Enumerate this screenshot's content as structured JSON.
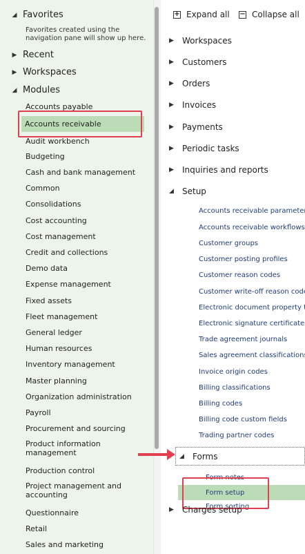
{
  "nav": {
    "favorites_label": "Favorites",
    "favorites_note": "Favorites created using the navigation pane will show up here.",
    "recent_label": "Recent",
    "workspaces_label": "Workspaces",
    "modules_label": "Modules",
    "modules": [
      "Accounts payable",
      "Accounts receivable",
      "Audit workbench",
      "Budgeting",
      "Cash and bank management",
      "Common",
      "Consolidations",
      "Cost accounting",
      "Cost management",
      "Credit and collections",
      "Demo data",
      "Expense management",
      "Fixed assets",
      "Fleet management",
      "General ledger",
      "Human resources",
      "Inventory management",
      "Master planning",
      "Organization administration",
      "Payroll",
      "Procurement and sourcing",
      "Product information management",
      "Production control",
      "Project management and accounting",
      "Questionnaire",
      "Retail",
      "Sales and marketing"
    ],
    "selected_module": "Accounts receivable"
  },
  "toolbar": {
    "expand_all": "Expand all",
    "collapse_all": "Collapse all"
  },
  "content": {
    "groups": {
      "workspaces": "Workspaces",
      "customers": "Customers",
      "orders": "Orders",
      "invoices": "Invoices",
      "payments": "Payments",
      "periodic_tasks": "Periodic tasks",
      "inquiries_reports": "Inquiries and reports",
      "setup": "Setup",
      "forms": "Forms",
      "charges_setup": "Charges setup"
    },
    "setup_items": [
      "Accounts receivable parameters",
      "Accounts receivable workflows",
      "Customer groups",
      "Customer posting profiles",
      "Customer reason codes",
      "Customer write-off reason codes",
      "Electronic document property typ",
      "Electronic signature certificates",
      "Trade agreement journals",
      "Sales agreement classifications",
      "Invoice origin codes",
      "Billing classifications",
      "Billing codes",
      "Billing code custom fields",
      "Trading partner codes"
    ],
    "forms_items": [
      "Form notes",
      "Form setup",
      "Form sorting"
    ],
    "selected_item": "Form setup"
  },
  "colors": {
    "nav_background": "#edf5ea",
    "selection": "#bcdcb7",
    "callout_red": "#e04050",
    "link_blue": "#1f3c7a"
  }
}
